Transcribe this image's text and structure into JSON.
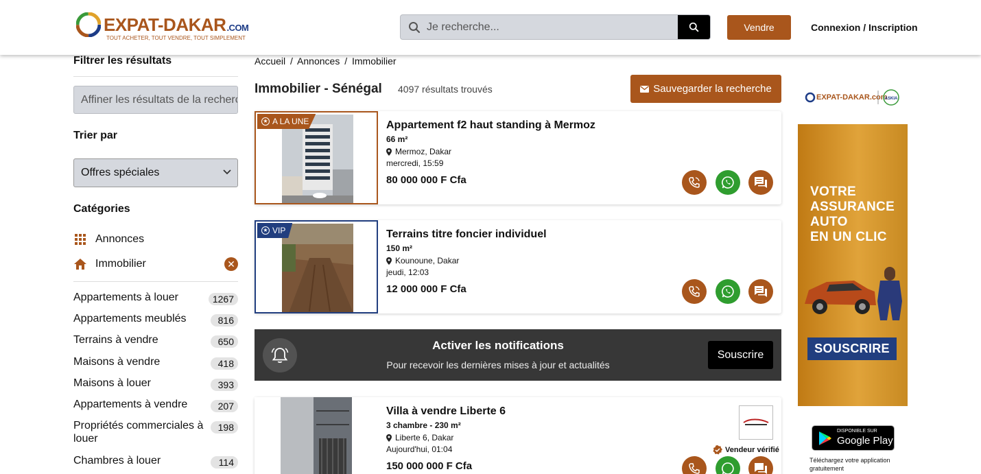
{
  "header": {
    "logo_text": "EXPAT-DAKAR",
    "logo_suffix": ".COM",
    "logo_tagline": "TOUT ACHETER, TOUT VENDRE, TOUT SIMPLEMENT",
    "search_placeholder": "Je recherche...",
    "sell_label": "Vendre",
    "login_label": "Connexion / Inscription"
  },
  "sidebar": {
    "filter_title": "Filtrer les résultats",
    "filter_placeholder": "Affiner les résultats de la recherche",
    "sort_title": "Trier par",
    "sort_value": "Offres spéciales",
    "categories_title": "Catégories",
    "categories": [
      {
        "label": "Annonces",
        "icon": "grid-icon"
      },
      {
        "label": "Immobilier",
        "icon": "home-icon"
      }
    ],
    "subcategories": [
      {
        "label": "Appartements à louer",
        "count": "1267"
      },
      {
        "label": "Appartements meublés",
        "count": "816"
      },
      {
        "label": "Terrains à vendre",
        "count": "650"
      },
      {
        "label": "Maisons à vendre",
        "count": "418"
      },
      {
        "label": "Maisons à louer",
        "count": "393"
      },
      {
        "label": "Appartements à vendre",
        "count": "207"
      },
      {
        "label": "Propriétés commerciales à louer",
        "count": "198"
      },
      {
        "label": "Chambres à louer",
        "count": "114"
      }
    ]
  },
  "main": {
    "breadcrumb": [
      "Accueil",
      "/",
      "Annonces",
      "/",
      "Immobilier"
    ],
    "title": "Immobilier - Sénégal",
    "result_count": "4097 résultats trouvés",
    "save_search_label": "Sauvegarder la recherche",
    "listings": [
      {
        "badge": "A LA UNE",
        "badge_color": "#a9561c",
        "title": "Appartement f2 haut standing à Mermoz",
        "size": "66 m²",
        "location": "Mermoz, Dakar",
        "date": "mercredi, 15:59",
        "price": "80 000 000 F Cfa"
      },
      {
        "badge": "VIP",
        "badge_color": "#213e7f",
        "title": "Terrains titre foncier individuel",
        "size": "150 m²",
        "location": "Kounoune, Dakar",
        "date": "jeudi, 12:03",
        "price": "12 000 000 F Cfa"
      },
      {
        "badge": "",
        "title": "Villa à vendre Liberte 6",
        "size": "3 chambre - 230 m²",
        "location": "Liberte 6, Dakar",
        "date": "Aujourd'hui, 01:04",
        "price": "150 000 000 F Cfa",
        "verified_label": "Vendeur vérifié"
      }
    ],
    "notification": {
      "title": "Activer les notifications",
      "subtitle": "Pour recevoir les dernières mises à jour et actualités",
      "button": "Souscrire"
    }
  },
  "ad": {
    "logo_text": "EXPAT-DAKAR.com",
    "partner_text": "ASKIA",
    "headline_lines": [
      "VOTRE",
      "ASSURANCE",
      "AUTO",
      "EN UN CLIC"
    ],
    "cta": "SOUSCRIRE",
    "gplay_small": "DISPONIBLE SUR",
    "gplay_big": "Google Play",
    "gplay_note": "Téléchargez votre application gratuitement"
  },
  "colors": {
    "brand": "#a9561c",
    "vip": "#213e7f",
    "whatsapp": "#2f9d2f",
    "dark_banner": "#373737"
  }
}
